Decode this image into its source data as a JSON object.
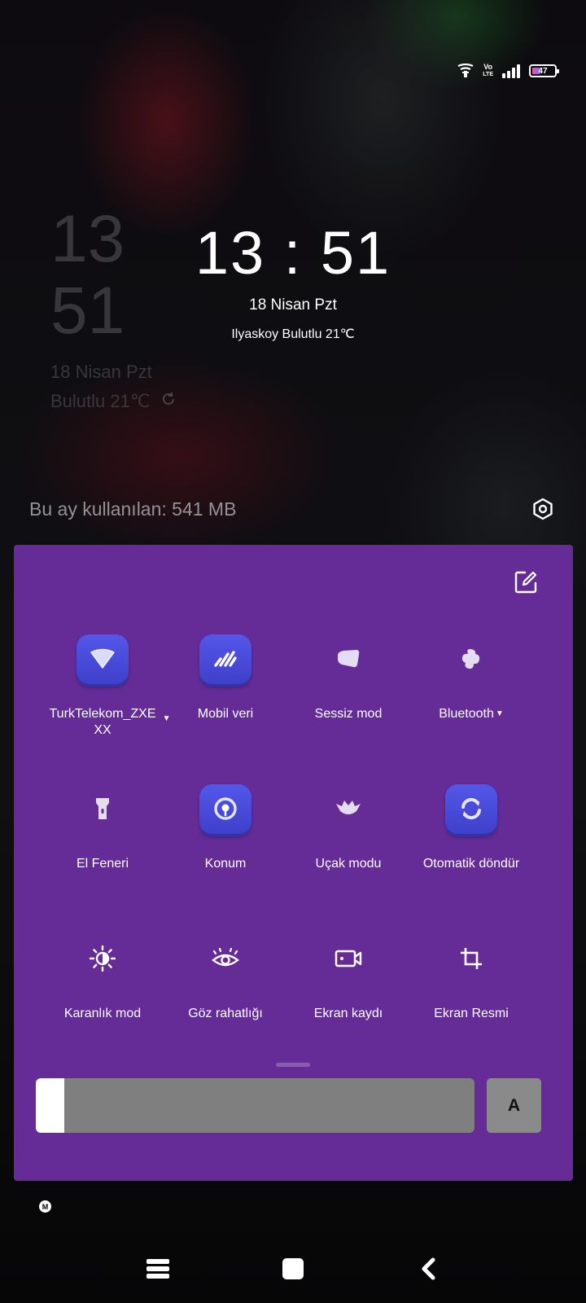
{
  "status_bar": {
    "icons": [
      "hotspot-icon",
      "volte-icon",
      "signal-icon",
      "battery-icon"
    ],
    "volte_label_top": "Vo",
    "volte_label_bottom": "LTE",
    "battery_level": "47"
  },
  "background_clock": {
    "hour": "13",
    "minute": "51",
    "date": "18 Nisan Pzt",
    "weather": "Bulutlu 21℃",
    "refresh_icon": "refresh-icon"
  },
  "lockscreen": {
    "time": "13 : 51",
    "date": "18 Nisan Pzt",
    "weather": "Ilyaskoy Bulutlu 21℃"
  },
  "data_usage": {
    "text": "Bu ay kullanılan: 541 MB",
    "settings_icon": "settings-icon"
  },
  "quick_settings": {
    "panel_color": "#652c98",
    "active_color": "#4a4cdb",
    "edit_icon": "edit-icon",
    "tiles": [
      {
        "label": "TurkTelekom_ZXE",
        "label2": "XX",
        "icon": "wifi-icon",
        "active": true,
        "has_dropdown": true
      },
      {
        "label": "Mobil veri",
        "icon": "mobile-data-icon",
        "active": true
      },
      {
        "label": "Sessiz mod",
        "icon": "silent-mode-icon",
        "active": false
      },
      {
        "label": "Bluetooth",
        "icon": "bluetooth-icon",
        "active": false,
        "has_dropdown": true
      },
      {
        "label": "El Feneri",
        "icon": "flashlight-icon",
        "active": false
      },
      {
        "label": "Konum",
        "icon": "location-icon",
        "active": true
      },
      {
        "label": "Uçak modu",
        "icon": "airplane-mode-icon",
        "active": false
      },
      {
        "label": "Otomatik döndür",
        "icon": "auto-rotate-icon",
        "active": true
      },
      {
        "label": "Karanlık mod",
        "icon": "dark-mode-icon",
        "active": false
      },
      {
        "label": "Göz rahatlığı",
        "icon": "eye-comfort-icon",
        "active": false
      },
      {
        "label": "Ekran kaydı",
        "icon": "screen-record-icon",
        "active": false
      },
      {
        "label": "Ekran Resmi",
        "icon": "screenshot-icon",
        "active": false
      }
    ],
    "brightness": {
      "level": 0.065,
      "auto_label": "A"
    }
  },
  "notification_badge": "M",
  "nav_bar": {
    "icons": [
      "menu-icon",
      "home-icon",
      "back-icon"
    ]
  }
}
